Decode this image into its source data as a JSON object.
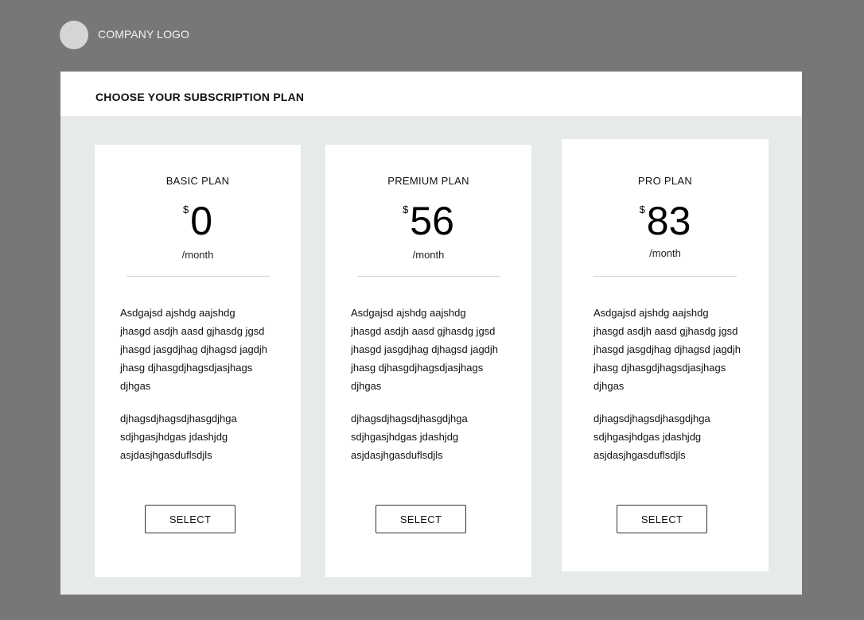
{
  "header": {
    "logo_text": "COMPANY LOGO"
  },
  "panel": {
    "title": "CHOOSE YOUR SUBSCRIPTION PLAN"
  },
  "plans": [
    {
      "name": "BASIC PLAN",
      "currency": "$",
      "price": "0",
      "period": "/month",
      "description_1": "Asdgajsd ajshdg aajshdg\njhasgd asdjh aasd gjhasdg jgsd\njhasgd jasgdjhag djhagsd jagdjh\njhasg djhasgdjhagsdjasjhags\ndjhgas",
      "description_2": "djhagsdjhagsdjhasgdjhga\nsdjhgasjhdgas jdashjdg\nasjdasjhgasduflsdjls",
      "button_label": "SELECT"
    },
    {
      "name": "PREMIUM PLAN",
      "currency": "$",
      "price": "56",
      "period": "/month",
      "description_1": "Asdgajsd ajshdg aajshdg\njhasgd asdjh aasd gjhasdg jgsd\njhasgd jasgdjhag djhagsd jagdjh\njhasg djhasgdjhagsdjasjhags\ndjhgas",
      "description_2": "djhagsdjhagsdjhasgdjhga\nsdjhgasjhdgas jdashjdg\nasjdasjhgasduflsdjls",
      "button_label": "SELECT"
    },
    {
      "name": "PRO PLAN",
      "currency": "$",
      "price": "83",
      "period": "/month",
      "description_1": "Asdgajsd ajshdg aajshdg\njhasgd asdjh aasd gjhasdg jgsd\njhasgd jasgdjhag djhagsd jagdjh\njhasg djhasgdjhagsdjasjhags\ndjhgas",
      "description_2": "djhagsdjhagsdjhasgdjhga\nsdjhgasjhdgas jdashjdg\nasjdasjhgasduflsdjls",
      "button_label": "SELECT"
    }
  ]
}
